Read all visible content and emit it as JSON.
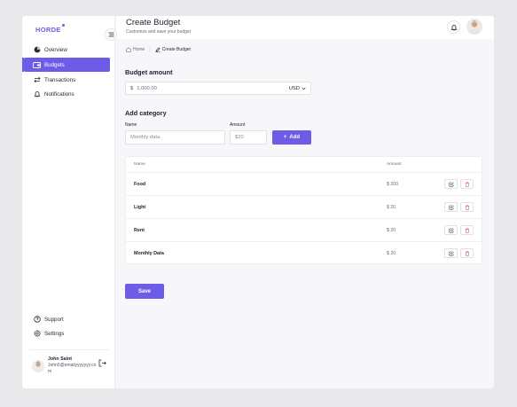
{
  "brand": {
    "name": "HORDE",
    "accent": "#6c5ce7"
  },
  "sidebar": {
    "items": [
      {
        "label": "Overview",
        "icon": "pie-chart-icon"
      },
      {
        "label": "Budgets",
        "icon": "wallet-icon",
        "active": true
      },
      {
        "label": "Transactions",
        "icon": "arrows-swap-icon"
      },
      {
        "label": "Notifications",
        "icon": "bell-icon"
      }
    ],
    "bottom_items": [
      {
        "label": "Support",
        "icon": "help-circle-icon"
      },
      {
        "label": "Settings",
        "icon": "gear-icon"
      }
    ],
    "user": {
      "name": "John Saint",
      "email": "John5@emailyyyyyyy.com"
    }
  },
  "header": {
    "title": "Create Budget",
    "subtitle": "Customize and save your budget"
  },
  "breadcrumb": {
    "home": "Home",
    "current": "Create Budget"
  },
  "budget": {
    "section_title": "Budget amount",
    "currency_symbol": "$",
    "amount_placeholder": "1,000.00",
    "currency": "USD"
  },
  "category": {
    "section_title": "Add category",
    "name_label": "Name",
    "name_placeholder": "Monthly data",
    "amount_label": "Amount",
    "amount_placeholder": "$20",
    "add_label": "Add"
  },
  "table": {
    "columns": [
      "Name",
      "Amount"
    ],
    "rows": [
      {
        "name": "Food",
        "amount": "$ 200"
      },
      {
        "name": "Light",
        "amount": "$ 20"
      },
      {
        "name": "Rent",
        "amount": "$ 20"
      },
      {
        "name": "Monthly Data",
        "amount": "$ 20"
      }
    ]
  },
  "save_label": "Save"
}
